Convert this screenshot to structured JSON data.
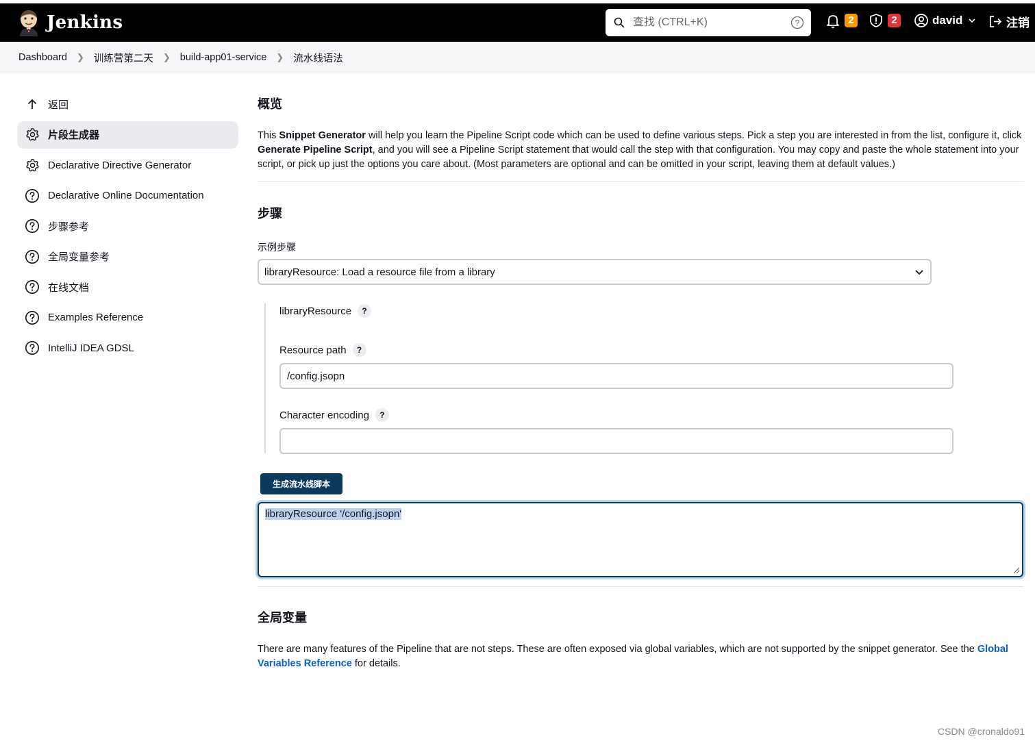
{
  "header": {
    "brand": "Jenkins",
    "search_placeholder": "查找 (CTRL+K)",
    "notifications_count": "2",
    "security_count": "2",
    "user": "david",
    "logout_label": "注销"
  },
  "breadcrumb": [
    "Dashboard",
    "训练营第二天",
    "build-app01-service",
    "流水线语法"
  ],
  "sidebar": {
    "items": [
      {
        "label": "返回",
        "icon": "arrow-up-icon"
      },
      {
        "label": "片段生成器",
        "icon": "gear-icon"
      },
      {
        "label": "Declarative Directive Generator",
        "icon": "gear-icon"
      },
      {
        "label": "Declarative Online Documentation",
        "icon": "help-circle-icon"
      },
      {
        "label": "步骤参考",
        "icon": "help-circle-icon"
      },
      {
        "label": "全局变量参考",
        "icon": "help-circle-icon"
      },
      {
        "label": "在线文档",
        "icon": "help-circle-icon"
      },
      {
        "label": "Examples Reference",
        "icon": "help-circle-icon"
      },
      {
        "label": "IntelliJ IDEA GDSL",
        "icon": "help-circle-icon"
      }
    ],
    "active_index": 1
  },
  "overview": {
    "title": "概览",
    "text_1": "This ",
    "bold_1": "Snippet Generator",
    "text_2": " will help you learn the Pipeline Script code which can be used to define various steps. Pick a step you are interested in from the list, configure it, click ",
    "bold_2": "Generate Pipeline Script",
    "text_3": ", and you will see a Pipeline Script statement that would call the step with that configuration. You may copy and paste the whole statement into your script, or pick up just the options you care about. (Most parameters are optional and can be omitted in your script, leaving them at default values.)"
  },
  "steps": {
    "title": "步骤",
    "sample_step_label": "示例步骤",
    "sample_step_value": "libraryResource: Load a resource file from a library",
    "step_name": "libraryResource",
    "resource_path_label": "Resource path",
    "resource_path_value": "/config.jsopn",
    "encoding_label": "Character encoding",
    "encoding_value": "",
    "generate_button": "生成流水线脚本",
    "output": "libraryResource '/config.jsopn'"
  },
  "global": {
    "title": "全局变量",
    "text_1": "There are many features of the Pipeline that are not steps. These are often exposed via global variables, which are not supported by the snippet generator. See the ",
    "link": "Global Variables Reference",
    "text_2": " for details."
  },
  "watermark": "CSDN @cronaldo91",
  "colors": {
    "header_bg": "#000000",
    "button_bg": "#0b3a5d",
    "link": "#0b60c4",
    "badge_orange": "#fe9a00",
    "badge_red": "#e5323e"
  }
}
